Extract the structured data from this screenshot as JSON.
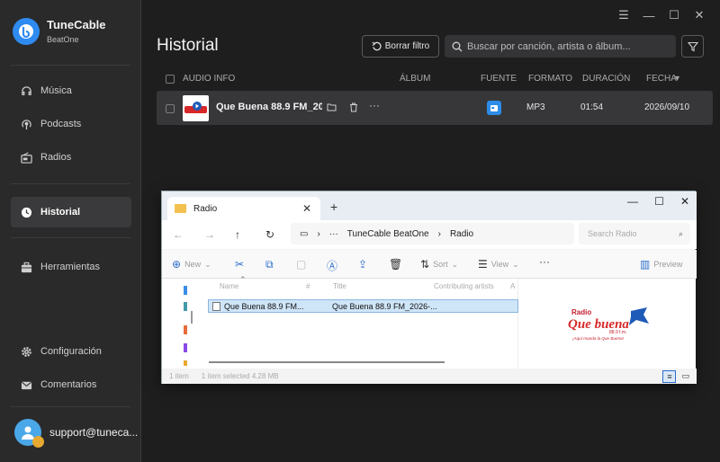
{
  "app": {
    "name": "TuneCable",
    "edition": "BeatOne"
  },
  "window_controls": [
    "☰",
    "—",
    "☐",
    "✕"
  ],
  "sidebar": {
    "items": [
      {
        "id": "musica",
        "label": "Música",
        "icon": "music-note-icon"
      },
      {
        "id": "podcasts",
        "label": "Podcasts",
        "icon": "podcast-icon"
      },
      {
        "id": "radios",
        "label": "Radios",
        "icon": "radio-icon"
      },
      {
        "id": "historial",
        "label": "Historial",
        "icon": "clock-icon",
        "active": true
      },
      {
        "id": "herramientas",
        "label": "Herramientas",
        "icon": "toolbox-icon"
      },
      {
        "id": "configuracion",
        "label": "Configuración",
        "icon": "gear-icon"
      },
      {
        "id": "comentarios",
        "label": "Comentarios",
        "icon": "mail-icon"
      }
    ],
    "user": {
      "email": "support@tuneca..."
    }
  },
  "header": {
    "title": "Historial",
    "reset_label": "Borrar filtro",
    "search_placeholder": "Buscar por canción, artista o álbum..."
  },
  "table": {
    "columns": {
      "audio_info": "AUDIO INFO",
      "album": "ÁLBUM",
      "source": "FUENTE",
      "format": "FORMATO",
      "duration": "DURACIÓN",
      "date": "FECHA"
    },
    "rows": [
      {
        "title": "Que Buena 88.9 FM_20...",
        "album": "",
        "format": "MP3",
        "duration": "01:54",
        "date": "2026/09/10"
      }
    ]
  },
  "explorer": {
    "tab_title": "Radio",
    "breadcrumb": [
      "TuneCable BeatOne",
      "Radio"
    ],
    "search_placeholder": "Search Radio",
    "toolbar": {
      "new": "New",
      "sort": "Sort",
      "view": "View",
      "preview": "Preview"
    },
    "columns": {
      "name": "Name",
      "num": "#",
      "title": "Title",
      "artists": "Contributing artists",
      "album": "A"
    },
    "file": {
      "name": "Que Buena 88.9 FM...",
      "title": "Que Buena 88.9 FM_2026-..."
    },
    "status": {
      "count": "1 item",
      "selected": "1 item selected  4.28 MB"
    },
    "preview_logo": {
      "top": "Radio",
      "main": "Que buena",
      "freq": "88.9 f.m.",
      "slogan": "¡Aquí manda la Que Buena!"
    }
  },
  "colors": {
    "accent": "#2e8bf0",
    "sidebar_bg": "#2a2a2b",
    "row_bg": "#37373a"
  }
}
